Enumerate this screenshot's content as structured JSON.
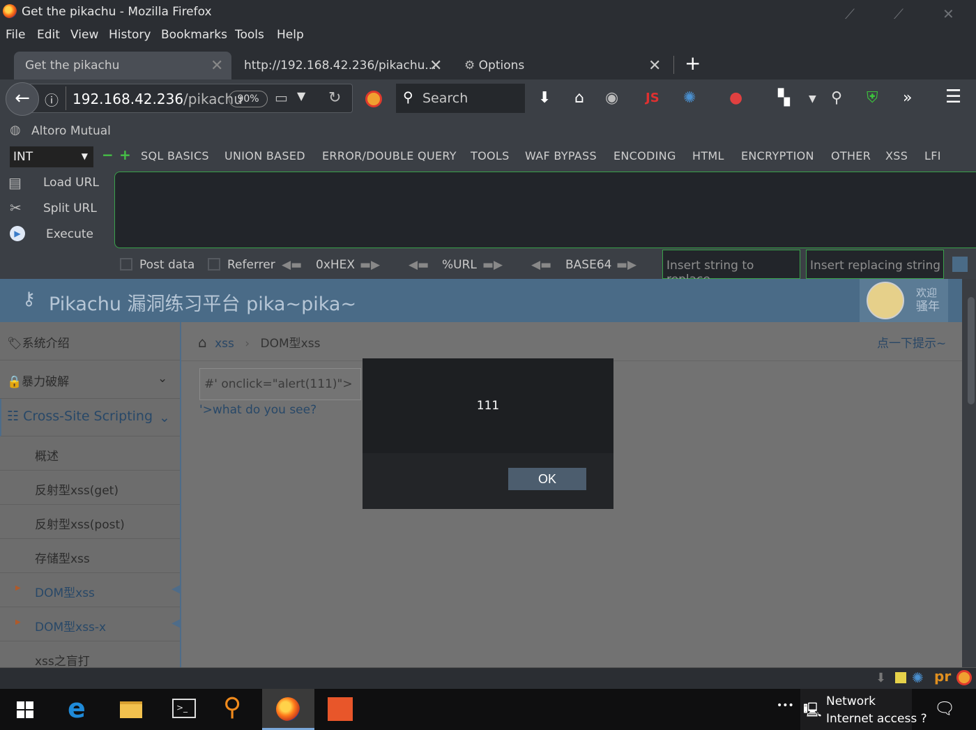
{
  "window": {
    "title": "Get the pikachu - Mozilla Firefox"
  },
  "menu": [
    "File",
    "Edit",
    "View",
    "History",
    "Bookmarks",
    "Tools",
    "Help"
  ],
  "tabs": [
    {
      "label": "Get the pikachu"
    },
    {
      "label": "http://192.168.42.236/pikachu..."
    },
    {
      "label": "Options"
    }
  ],
  "navbar": {
    "url_host": "192.168.42.236",
    "url_path": "/pikachu",
    "zoom": "90%",
    "search_placeholder": "Search"
  },
  "bookmarks": {
    "item": "Altoro Mutual"
  },
  "hackbar": {
    "select": "INT",
    "menus": [
      "SQL BASICS",
      "UNION BASED",
      "ERROR/DOUBLE QUERY",
      "TOOLS",
      "WAF BYPASS",
      "ENCODING",
      "HTML",
      "ENCRYPTION",
      "OTHER",
      "XSS",
      "LFI"
    ],
    "side": [
      "Load URL",
      "Split URL",
      "Execute"
    ],
    "post_data": "Post data",
    "referrer": "Referrer",
    "hex": "0xHEX",
    "url": "%URL",
    "base64": "BASE64",
    "replace_placeholder": "Insert string to replace",
    "replacing_placeholder": "Insert replacing string"
  },
  "pika": {
    "title": "Pikachu 漏洞练习平台 pika~pika~",
    "welcome_1": "欢迎",
    "welcome_2": "骚年"
  },
  "sidebar": {
    "sys": "系统介绍",
    "brute": "暴力破解",
    "xss": "Cross-Site Scripting",
    "items": [
      "概述",
      "反射型xss(get)",
      "反射型xss(post)",
      "存储型xss",
      "DOM型xss",
      "DOM型xss-x",
      "xss之盲打"
    ]
  },
  "main": {
    "crumb_1": "xss",
    "crumb_sep": "›",
    "crumb_2": "DOM型xss",
    "hint": "点一下提示~",
    "input_value": "#' onclick=\"alert(111)\">",
    "link_text": "'>what do you see?"
  },
  "dialog": {
    "message": "111",
    "ok": "OK"
  },
  "tray": {
    "network": "Network",
    "internet": "Internet access ?",
    "dots": "•••"
  },
  "colors": {
    "accent": "#4a6b87",
    "hackbar_green": "#39a24a",
    "dialog_bg": "#1d1f22"
  }
}
